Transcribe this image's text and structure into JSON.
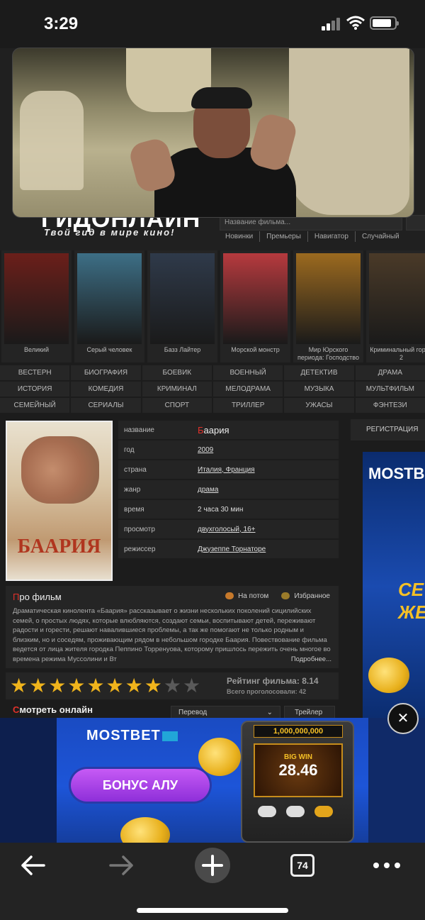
{
  "status_bar": {
    "time": "3:29",
    "battery_level": 0.85
  },
  "site": {
    "logo": "ГИДОНЛАЙН",
    "tagline": "Твой гид в мире кино!",
    "search_placeholder": "Название фильма...",
    "nav": [
      "Новинки",
      "Премьеры",
      "Навигатор",
      "Случайный"
    ]
  },
  "carousel": [
    {
      "title": "Великий",
      "color": "#6b1f1a"
    },
    {
      "title": "Серый человек",
      "color": "#3d6f86"
    },
    {
      "title": "Базз Лайтер",
      "color": "#2f3a4a"
    },
    {
      "title": "Морской монстр",
      "color": "#b73a3e"
    },
    {
      "title": "Мир Юрского периода: Господство",
      "color": "#9c6a1f"
    },
    {
      "title": "Криминальный город 2",
      "color": "#4a3a28"
    }
  ],
  "genres": [
    "ВЕСТЕРН",
    "БИОГРАФИЯ",
    "БОЕВИК",
    "ВОЕННЫЙ",
    "ДЕТЕКТИВ",
    "ДРАМА",
    "ИСТОРИЯ",
    "КОМЕДИЯ",
    "КРИМИНАЛ",
    "МЕЛОДРАМА",
    "МУЗЫКА",
    "МУЛЬТФИЛЬМ",
    "СЕМЕЙНЫЙ",
    "СЕРИАЛЫ",
    "СПОРТ",
    "ТРИЛЛЕР",
    "УЖАСЫ",
    "ФЭНТЕЗИ"
  ],
  "film": {
    "poster_title": "БААРИЯ",
    "rows": [
      {
        "label": "название",
        "value": "Баария"
      },
      {
        "label": "год",
        "value": "2009"
      },
      {
        "label": "страна",
        "value": "Италия, Франция"
      },
      {
        "label": "жанр",
        "value": "драма"
      },
      {
        "label": "время",
        "value": "2 часа 30 мин"
      },
      {
        "label": "просмотр",
        "value": "двухголосый, 16+"
      },
      {
        "label": "режиссер",
        "value": "Джузеппе Торнаторе"
      }
    ]
  },
  "about": {
    "title_first": "П",
    "title_rest": "ро фильм",
    "later": "На потом",
    "favorite": "Избранное",
    "text": "Драматическая кинолента «Баария» рассказывает о жизни нескольких поколений сицилийских семей, о простых людях, которые влюбляются, создают семьи, воспитывают детей, переживают радости и горести, решают навалившиеся проблемы, а так же помогают не только родным и близким, но и соседям, проживающим рядом в небольшом городке Баария. Повествование фильма ведется от лица жителя городка Пеппино Торренуова, которому пришлось пережить очень многое во времена режима Муссолини и Вт",
    "more": "Подробнее..."
  },
  "rating": {
    "value": 8.14,
    "max": 10,
    "label": "Рейтинг фильма: 8.14",
    "votes": "Всего проголосовали: 42"
  },
  "watch": {
    "title_first": "С",
    "title_rest": "мотреть онлайн",
    "select_value": "Перевод",
    "trailer": "Трейлер ▸"
  },
  "sidebar": {
    "register": "РЕГИСТРАЦИЯ",
    "ad_logo": "MOSTBET",
    "ad_promo": "СЕ ЖЕН"
  },
  "banner": {
    "logo": "MOSTBET",
    "cta": "БОНУС АЛУ",
    "jackpot": "1,000,000,000",
    "big_win": "BIG WIN",
    "amount": "28.46",
    "close": "✕"
  },
  "toolbar": {
    "tab_count": "74"
  }
}
